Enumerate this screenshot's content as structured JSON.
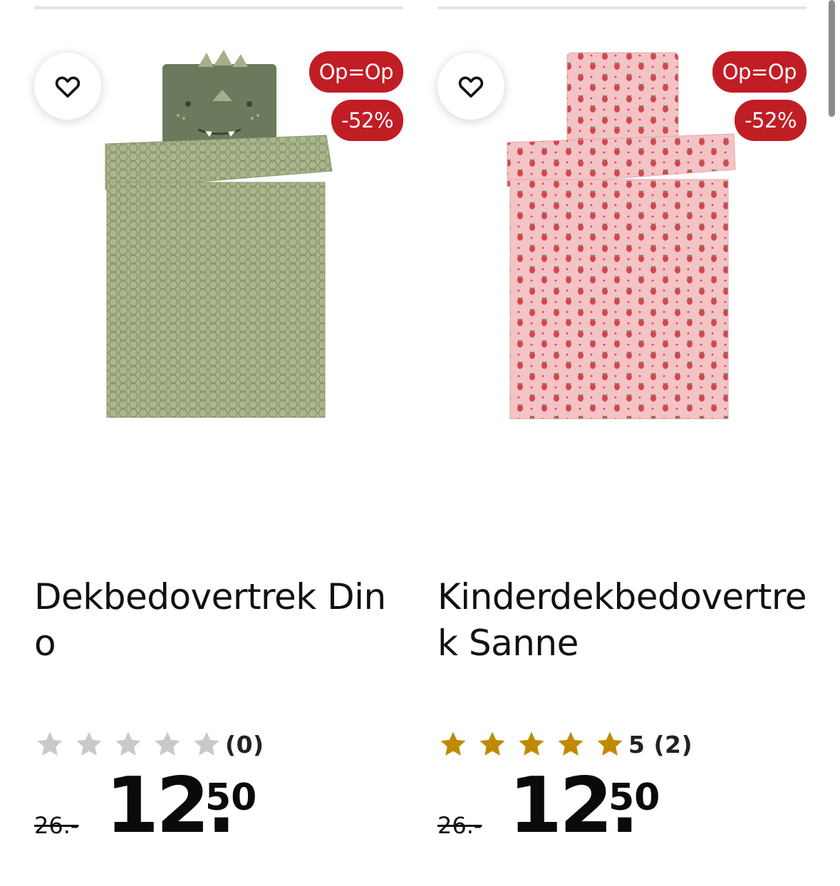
{
  "products": [
    {
      "name": "Dekbedovertrek Dino",
      "badges": [
        "Op=Op",
        "-52%"
      ],
      "rating": 0,
      "rating_label": "(0)",
      "old_price": "26.-",
      "price_main": "12.",
      "price_cents": "50",
      "image_icon": "dino-duvet-image"
    },
    {
      "name": "Kinderdekbedovertrek Sanne",
      "badges": [
        "Op=Op",
        "-52%"
      ],
      "rating": 5,
      "rating_label": "5 (2)",
      "old_price": "26.-",
      "price_main": "12.",
      "price_cents": "50",
      "image_icon": "strawberry-duvet-image"
    }
  ],
  "colors": {
    "badge": "#c11d25",
    "star_filled": "#c08a00",
    "star_empty": "#c9c9c9",
    "dino_fabric": "#9fab83",
    "dino_pillow": "#6b7a5c",
    "sanne_fabric": "#f3c1c4",
    "strawberry": "#d9434e"
  },
  "icons": {
    "favorite": "heart-outline-icon",
    "star": "star-icon"
  }
}
